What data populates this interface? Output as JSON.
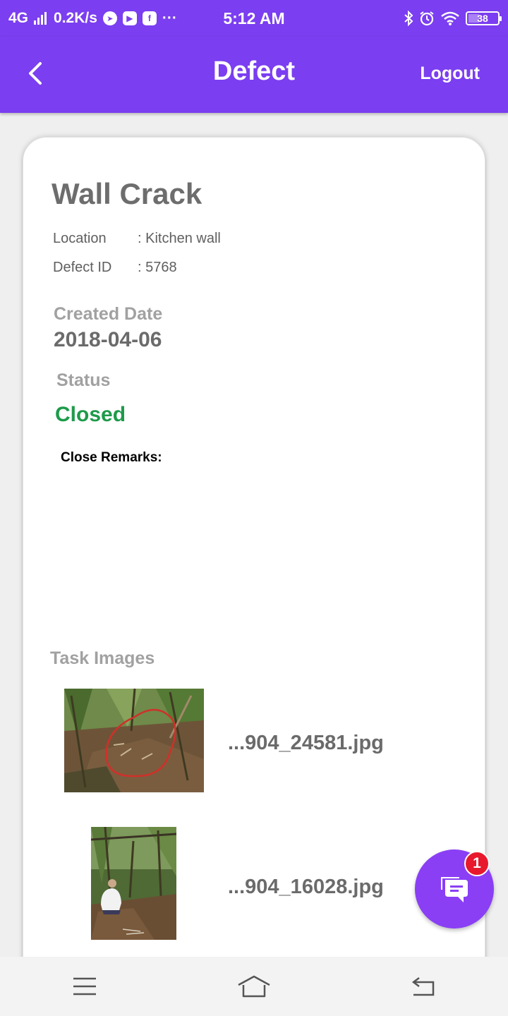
{
  "status_bar": {
    "network": "4G",
    "speed": "0.2K/s",
    "more": "···",
    "time": "5:12 AM",
    "battery": "38",
    "battery_level": 0.38,
    "icons": [
      "signal-icon",
      "telegram-icon",
      "youtube-icon",
      "facebook-icon",
      "bluetooth-icon",
      "alarm-icon",
      "wifi-icon",
      "battery-icon"
    ]
  },
  "app_bar": {
    "title": "Defect",
    "logout_label": "Logout",
    "back_icon": "chevron-left-icon",
    "color": "#7b3ef0"
  },
  "defect": {
    "title": "Wall Crack",
    "location_label": "Location",
    "location_value": ": Kitchen wall",
    "defect_id_label": "Defect ID",
    "defect_id_value": ": 5768",
    "created_label": "Created Date",
    "created_value": "2018-04-06",
    "status_label": "Status",
    "status_value": "Closed",
    "status_color": "#1e9a4a",
    "remarks_label": "Close Remarks:"
  },
  "task_images": {
    "label": "Task Images",
    "items": [
      {
        "file": "...904_24581.jpg"
      },
      {
        "file": "...904_16028.jpg"
      }
    ]
  },
  "fab": {
    "icon": "chat-icon",
    "badge": "1",
    "color": "#8a3ff5",
    "badge_color": "#e8192c"
  },
  "nav_bar": {
    "icons": [
      "menu-icon",
      "home-icon",
      "back-icon"
    ]
  }
}
